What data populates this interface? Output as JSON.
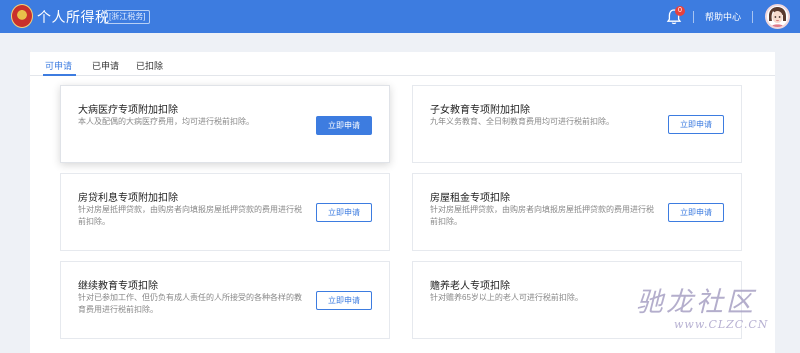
{
  "header": {
    "app_title": "个人所得税",
    "region_badge": "[浙江税务]",
    "notification_count": "0",
    "help_label": "帮助中心"
  },
  "tabs": [
    {
      "label": "可申请",
      "active": true
    },
    {
      "label": "已申请",
      "active": false
    },
    {
      "label": "已扣除",
      "active": false
    }
  ],
  "cards": [
    {
      "title": "大病医疗专项附加扣除",
      "desc": "本人及配偶的大病医疗费用，均可进行税前扣除。",
      "button": "立即申请",
      "button_style": "primary"
    },
    {
      "title": "子女教育专项附加扣除",
      "desc": "九年义务教育、全日制教育费用均可进行税前扣除。",
      "button": "立即申请",
      "button_style": "outline"
    },
    {
      "title": "房贷利息专项附加扣除",
      "desc": "针对房屋抵押贷款，由购房者向填报房屋抵押贷款的费用进行税前扣除。",
      "button": "立即申请",
      "button_style": "outline"
    },
    {
      "title": "房屋租金专项扣除",
      "desc": "针对房屋抵押贷款，由购房者向填报房屋抵押贷款的费用进行税前扣除。",
      "button": "立即申请",
      "button_style": "outline"
    },
    {
      "title": "继续教育专项扣除",
      "desc": "针对已参加工作、但仍负有成人责任的人所接受的各种各样的教育费用进行税前扣除。",
      "button": "立即申请",
      "button_style": "outline"
    },
    {
      "title": "赡养老人专项扣除",
      "desc": "针对赡养65岁以上的老人可进行税前扣除。",
      "button": "",
      "button_style": "none"
    }
  ],
  "watermark": {
    "text": "驰龙社区",
    "url": "www.CLZC.CN"
  },
  "colors": {
    "primary": "#3d7ce0",
    "notification": "#e8413c",
    "page_bg": "#eef1f6"
  },
  "icons": {
    "emblem": "tax-emblem-icon",
    "bell": "bell-icon",
    "avatar": "user-avatar-icon"
  }
}
